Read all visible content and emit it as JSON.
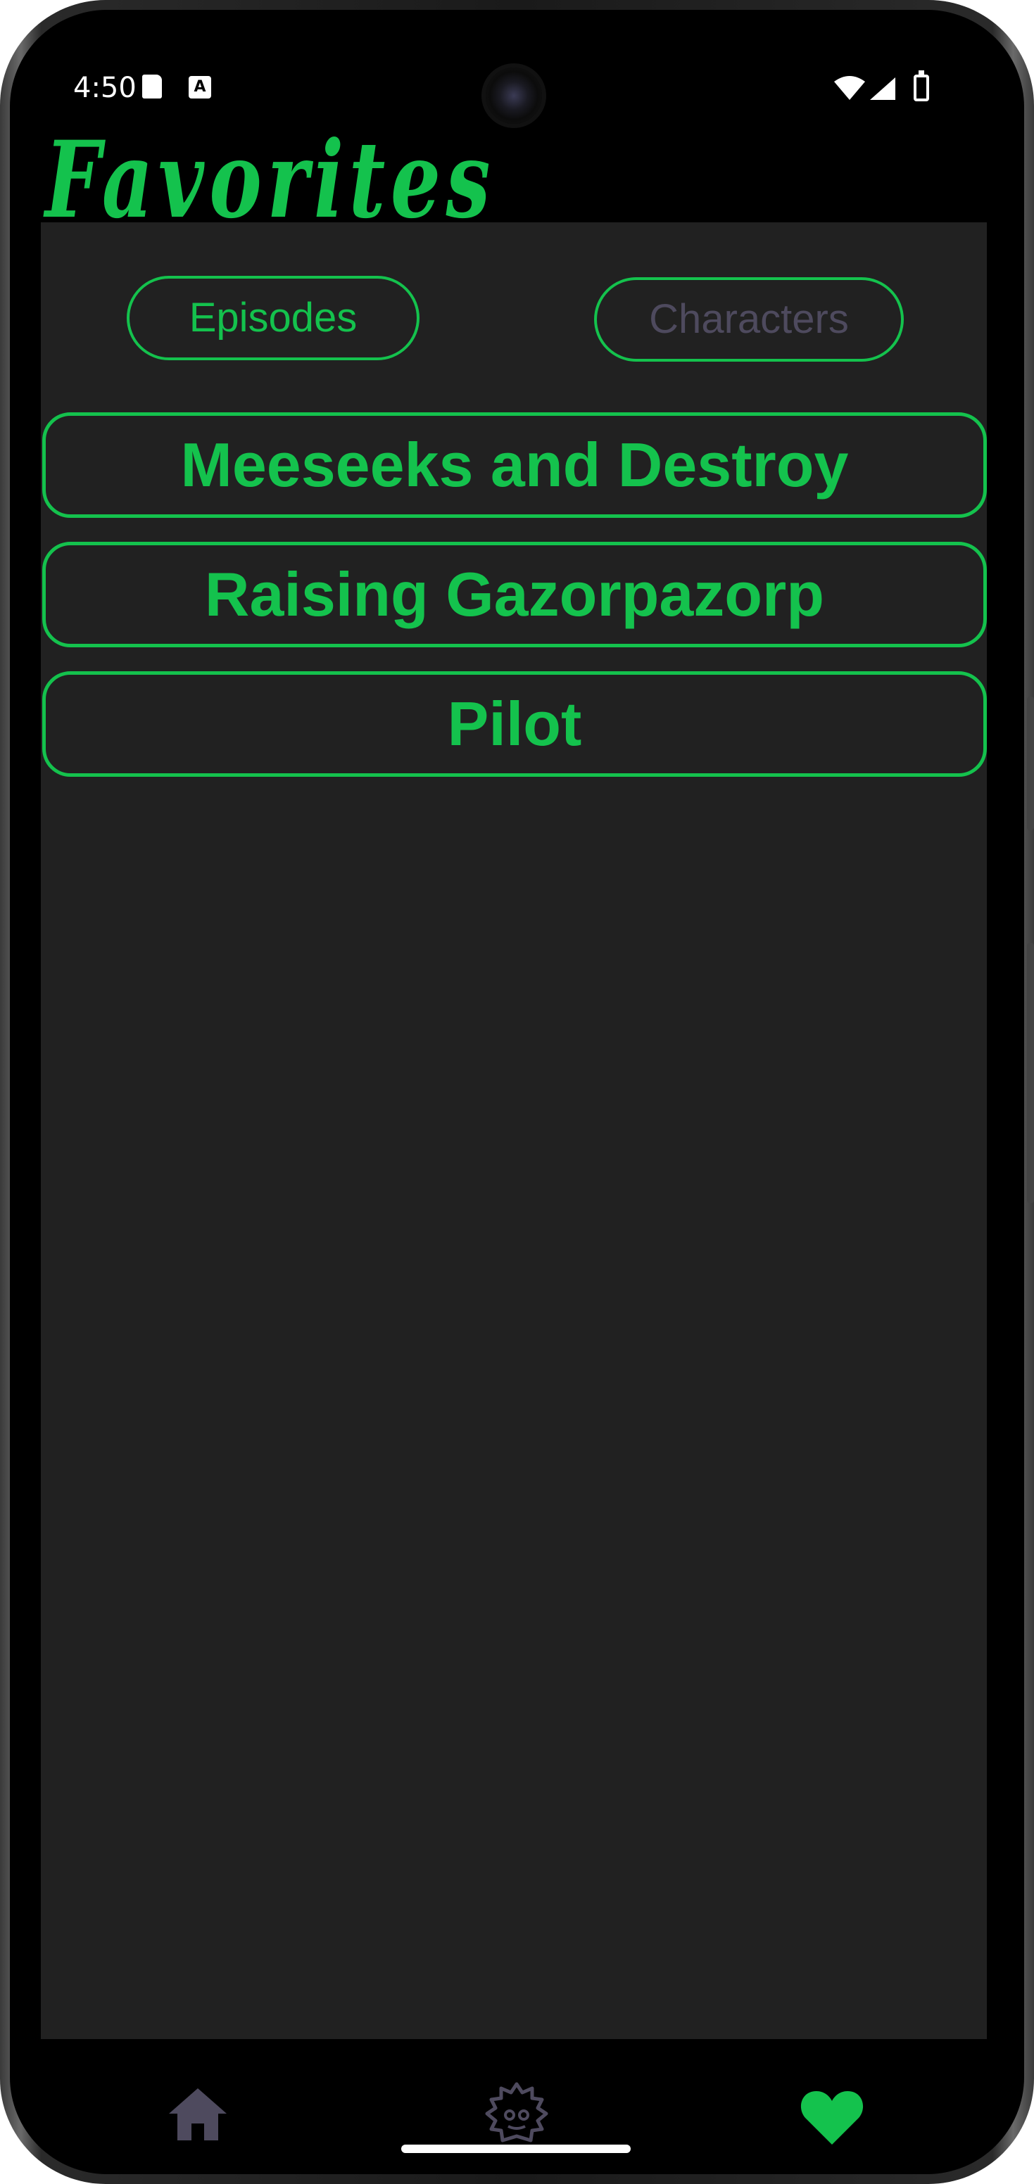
{
  "status_bar": {
    "time": "4:50",
    "sd_icon": "sd-card-icon",
    "a_icon": "A",
    "wifi_icon": "wifi-icon",
    "signal_icon": "cell-signal-icon",
    "battery_icon": "battery-icon"
  },
  "header": {
    "title": "Favorites",
    "title_color": "#14c24d"
  },
  "tabs": [
    {
      "label": "Episodes",
      "selected": true
    },
    {
      "label": "Characters",
      "selected": false
    }
  ],
  "favorites": [
    {
      "name": "Meeseeks and Destroy"
    },
    {
      "name": "Raising Gazorpazorp"
    },
    {
      "name": "Pilot"
    }
  ],
  "bottom_nav": {
    "items": [
      {
        "icon": "home-icon",
        "active": false
      },
      {
        "icon": "character-icon",
        "active": false
      },
      {
        "icon": "heart-icon",
        "active": true
      }
    ]
  },
  "colors": {
    "accent": "#14c24d",
    "inactive": "#4e4a5e",
    "panel": "#212121",
    "background": "#000000"
  }
}
